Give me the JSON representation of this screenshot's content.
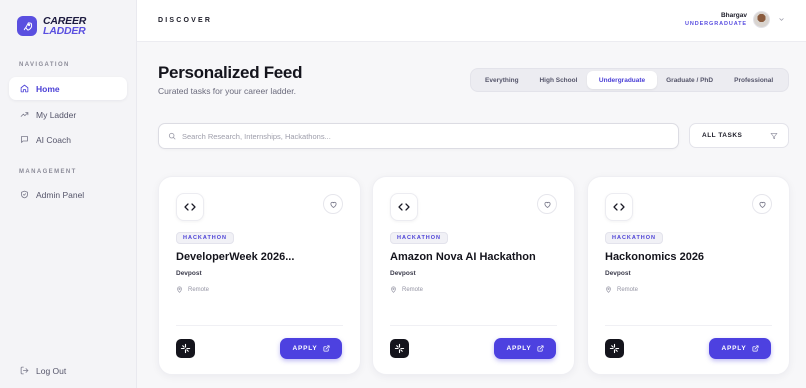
{
  "brand": {
    "line1": "CAREER",
    "line2": "LADDER"
  },
  "sidebar": {
    "navigation_heading": "NAVIGATION",
    "management_heading": "MANAGEMENT",
    "items": [
      {
        "label": "Home",
        "icon": "home-icon",
        "active": true
      },
      {
        "label": "My Ladder",
        "icon": "trending-up-icon"
      },
      {
        "label": "AI Coach",
        "icon": "chat-icon"
      },
      {
        "label": "Admin Panel",
        "icon": "shield-icon"
      }
    ],
    "logout": "Log Out"
  },
  "header": {
    "section": "DISCOVER",
    "user": {
      "name": "Bhargav",
      "role": "UNDERGRADUATE"
    }
  },
  "page": {
    "title": "Personalized Feed",
    "subtitle": "Curated tasks for your career ladder."
  },
  "tabs": [
    "Everything",
    "High School",
    "Undergraduate",
    "Graduate / PhD",
    "Professional"
  ],
  "active_tab": "Undergraduate",
  "search": {
    "placeholder": "Search Research, Internships, Hackathons..."
  },
  "filter": {
    "label": "ALL TASKS"
  },
  "cards": [
    {
      "tag": "HACKATHON",
      "title": "DeveloperWeek 2026...",
      "org": "Devpost",
      "location": "Remote",
      "apply": "APPLY"
    },
    {
      "tag": "HACKATHON",
      "title": "Amazon Nova AI Hackathon",
      "org": "Devpost",
      "location": "Remote",
      "apply": "APPLY"
    },
    {
      "tag": "HACKATHON",
      "title": "Hackonomics 2026",
      "org": "Devpost",
      "location": "Remote",
      "apply": "APPLY"
    }
  ],
  "colors": {
    "accent": "#5a4fe0",
    "button": "#4d41e0",
    "dark": "#14141c"
  }
}
